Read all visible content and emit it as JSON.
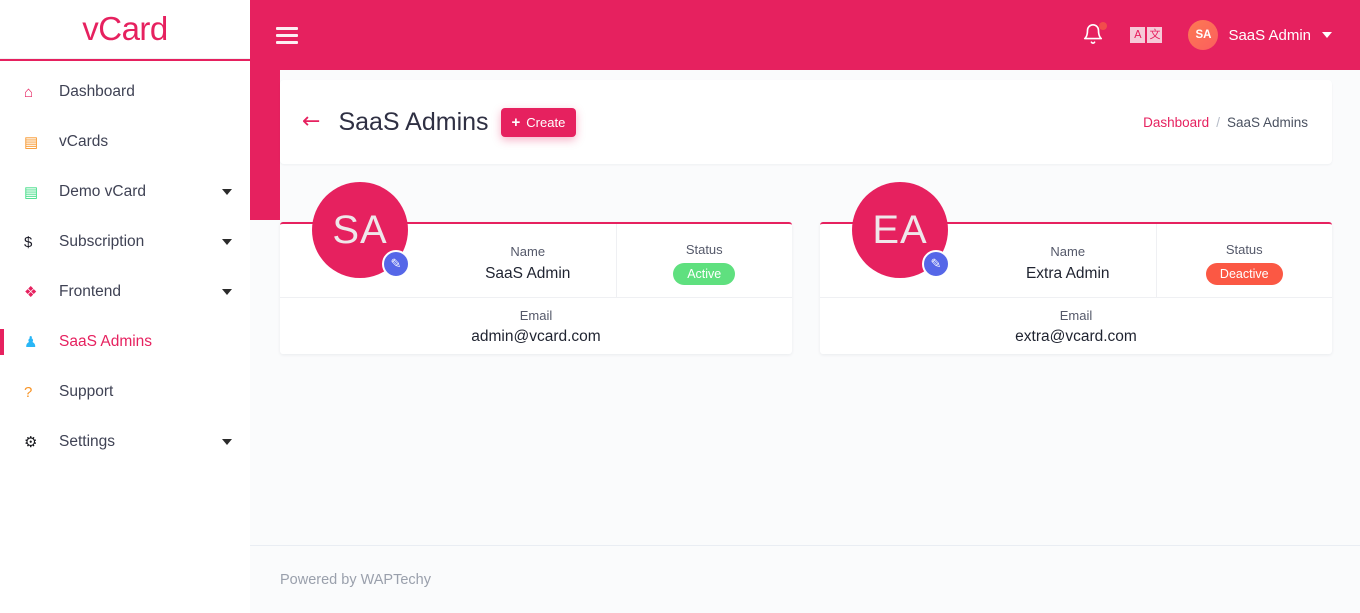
{
  "brand": {
    "name": "vCard"
  },
  "sidebar": {
    "items": [
      {
        "label": "Dashboard",
        "icon": "home-icon",
        "glyph": "⌂",
        "color": "#e6215f",
        "caret": false,
        "active": false
      },
      {
        "label": "vCards",
        "icon": "contact-card-icon",
        "glyph": "▤",
        "color": "#f79427",
        "caret": false,
        "active": false
      },
      {
        "label": "Demo vCard",
        "icon": "id-card-icon",
        "glyph": "▤",
        "color": "#3ddc84",
        "caret": true,
        "active": false
      },
      {
        "label": "Subscription",
        "icon": "dollar-icon",
        "glyph": "$",
        "color": "#1c1c28",
        "caret": true,
        "active": false
      },
      {
        "label": "Frontend",
        "icon": "puzzle-icon",
        "glyph": "❖",
        "color": "#e6215f",
        "caret": true,
        "active": false
      },
      {
        "label": "SaaS Admins",
        "icon": "user-tie-icon",
        "glyph": "♟",
        "color": "#29b6f6",
        "caret": false,
        "active": true
      },
      {
        "label": "Support",
        "icon": "question-circle-icon",
        "glyph": "?",
        "color": "#f79427",
        "caret": false,
        "active": false
      },
      {
        "label": "Settings",
        "icon": "gear-icon",
        "glyph": "⚙",
        "color": "#16171c",
        "caret": true,
        "active": false
      }
    ]
  },
  "topbar": {
    "menu_toggle": "hamburger-icon",
    "notification_icon": "bell-icon",
    "language_icon": "translate-icon",
    "language_glyph_left": "A",
    "language_glyph_right": "文",
    "user_initials": "SA",
    "user_name": "SaaS Admin"
  },
  "page": {
    "back_label": "←",
    "title": "SaaS Admins",
    "create_label": "Create",
    "create_plus": "+"
  },
  "breadcrumb": {
    "link": "Dashboard",
    "separator": "/",
    "current": "SaaS Admins"
  },
  "labels": {
    "name": "Name",
    "status": "Status",
    "email": "Email",
    "edit_glyph": "✎"
  },
  "admins": [
    {
      "initials": "SA",
      "name": "SaaS Admin",
      "status": "Active",
      "status_type": "active",
      "email": "admin@vcard.com"
    },
    {
      "initials": "EA",
      "name": "Extra Admin",
      "status": "Deactive",
      "status_type": "deactive",
      "email": "extra@vcard.com"
    }
  ],
  "footer": {
    "text": "Powered by WAPTechy"
  },
  "colors": {
    "brand_pink": "#e6215f",
    "active_green": "#5fe07f",
    "deactive_red": "#fb5844",
    "edit_blue": "#5667e8",
    "avatar_orange": "#fd7a52"
  }
}
